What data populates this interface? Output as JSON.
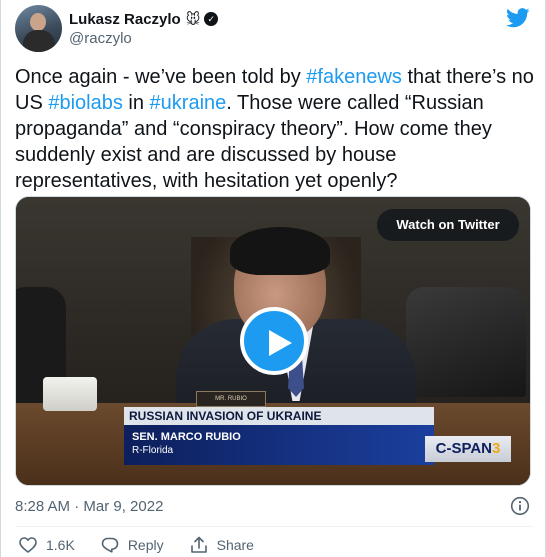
{
  "author": {
    "display_name": "Lukasz Raczylo",
    "emoji": "🐭",
    "handle": "@raczylo",
    "verified_glyph": "✓"
  },
  "tweet": {
    "text_parts": [
      {
        "text": "Once again - we’ve been told by ",
        "tag": false
      },
      {
        "text": "#fakenews",
        "tag": true
      },
      {
        "text": " that there’s no US ",
        "tag": false
      },
      {
        "text": "#biolabs",
        "tag": true
      },
      {
        "text": " in ",
        "tag": false
      },
      {
        "text": "#ukraine",
        "tag": true
      },
      {
        "text": ". Those were called “Russian propaganda” and “conspiracy theory”. How come they suddenly exist and are discussed by house representatives, with hesitation yet openly?",
        "tag": false
      }
    ]
  },
  "video": {
    "watch_label": "Watch on Twitter",
    "nameplate": "MR. RUBIO",
    "chyron_headline": "RUSSIAN INVASION OF UKRAINE",
    "chyron_name": "SEN. MARCO RUBIO",
    "chyron_party": "R-Florida",
    "network_prefix": "C-SPAN",
    "network_number": "3"
  },
  "footer": {
    "timestamp": "8:28 AM · Mar 9, 2022",
    "likes": "1.6K",
    "reply_label": "Reply",
    "share_label": "Share"
  },
  "colors": {
    "accent": "#1d9bf0",
    "text": "#0f1419",
    "muted": "#536471"
  },
  "icons": [
    "twitter-bird-icon",
    "verified-icon",
    "play-icon",
    "info-icon",
    "heart-icon",
    "reply-icon",
    "share-icon"
  ]
}
